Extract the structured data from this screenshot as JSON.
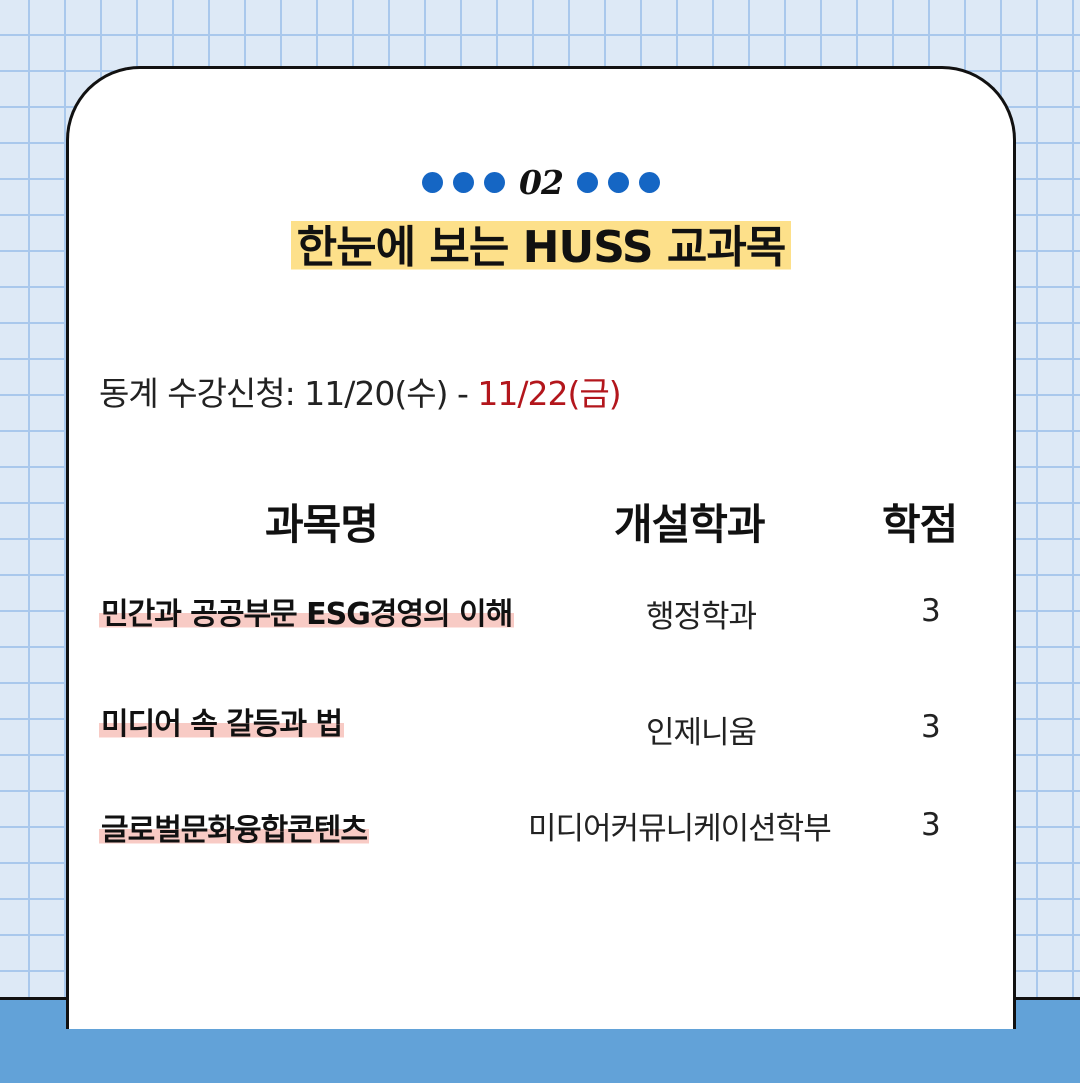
{
  "header": {
    "number": "02",
    "title": "한눈에 보는 HUSS 교과목"
  },
  "registration": {
    "label": "동계 수강신청: 11/20(수) - ",
    "end_date": "11/22(금)"
  },
  "table": {
    "headers": {
      "course": "과목명",
      "department": "개설학과",
      "credit": "학점"
    },
    "rows": [
      {
        "course": "민간과 공공부문 ESG경영의 이해",
        "department": "행정학과",
        "credit": "3"
      },
      {
        "course": "미디어 속 갈등과 법",
        "department": "인제니움",
        "credit": "3"
      },
      {
        "course": "글로벌문화융합콘텐츠",
        "department": "미디어커뮤니케이션학부",
        "credit": "3"
      }
    ]
  },
  "colors": {
    "dot_blue": "#1566c4",
    "title_highlight": "#fde08a",
    "course_highlight": "#f8cbc5",
    "end_date_red": "#b3161c",
    "bottom_band": "#62a2d8",
    "grid_background": "#dde9f6"
  }
}
